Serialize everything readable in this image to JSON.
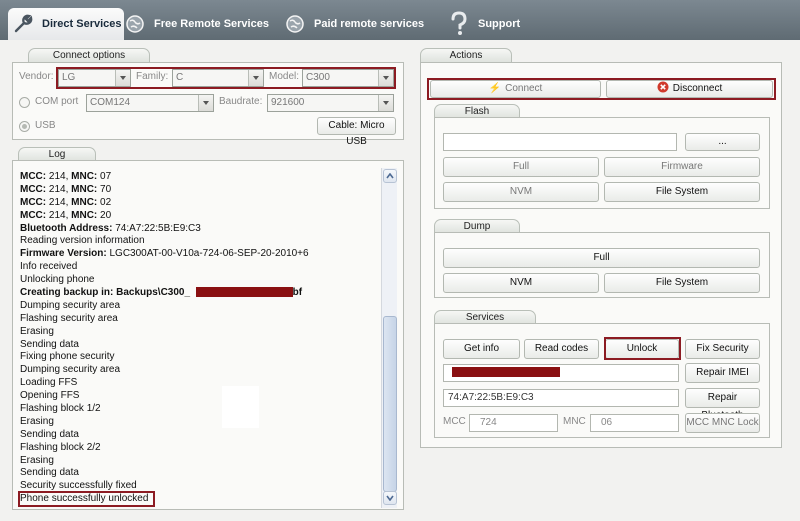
{
  "tabs": [
    {
      "label": "Direct Services",
      "icon": "wrench-icon",
      "active": true
    },
    {
      "label": "Free Remote Services",
      "icon": "globe-icon"
    },
    {
      "label": "Paid remote services",
      "icon": "globe-icon"
    },
    {
      "label": "Support",
      "icon": "question-icon"
    }
  ],
  "connect_options": {
    "title": "Connect options",
    "vendor_label": "Vendor:",
    "vendor_value": "LG",
    "family_label": "Family:",
    "family_value": "C",
    "model_label": "Model:",
    "model_value": "C300",
    "com_label": "COM port",
    "com_value": "COM124",
    "baud_label": "Baudrate:",
    "baud_value": "921600",
    "usb_label": "USB",
    "cable_button": "Cable: Micro USB"
  },
  "log": {
    "title": "Log",
    "lines": [
      {
        "label": "MCC:",
        "text": " 214, ",
        "label2": "MNC:",
        "text2": " 07"
      },
      {
        "label": "MCC:",
        "text": " 214, ",
        "label2": "MNC:",
        "text2": " 70"
      },
      {
        "label": "MCC:",
        "text": " 214, ",
        "label2": "MNC:",
        "text2": " 02"
      },
      {
        "label": "MCC:",
        "text": " 214, ",
        "label2": "MNC:",
        "text2": " 20"
      },
      {
        "label": "Bluetooth Address:",
        "text": " 74:A7:22:5B:E9:C3"
      },
      {
        "text": "Reading version information"
      },
      {
        "label": "Firmware Version:",
        "text": " LGC300AT-00-V10a-724-06-SEP-20-2010+6"
      },
      {
        "text": "Info received"
      },
      {
        "text": "Unlocking phone"
      },
      {
        "bold": "Creating backup in: Backups\\C300_",
        "suffix": "sbf"
      },
      {
        "text": "Dumping security area"
      },
      {
        "text": "Flashing security area"
      },
      {
        "text": "Erasing"
      },
      {
        "text": "Sending data"
      },
      {
        "text": "Fixing phone security"
      },
      {
        "text": "Dumping security area"
      },
      {
        "text": "Loading FFS"
      },
      {
        "text": "Opening FFS"
      },
      {
        "text": "Flashing block 1/2"
      },
      {
        "text": "Erasing"
      },
      {
        "text": "Sending data"
      },
      {
        "text": "Flashing block 2/2"
      },
      {
        "text": "Erasing"
      },
      {
        "text": "Sending data"
      },
      {
        "text": "Security successfully fixed"
      },
      {
        "text": "Phone successfully unlocked"
      }
    ]
  },
  "actions": {
    "title": "Actions",
    "connect_button": "Connect",
    "disconnect_button": "Disconnect"
  },
  "flash": {
    "title": "Flash",
    "path_value": "",
    "browse_button": "...",
    "full_button": "Full",
    "firmware_button": "Firmware",
    "nvm_button": "NVM",
    "filesystem_button": "File System"
  },
  "dump": {
    "title": "Dump",
    "full_button": "Full",
    "nvm_button": "NVM",
    "filesystem_button": "File System"
  },
  "services": {
    "title": "Services",
    "get_info_button": "Get info",
    "read_codes_button": "Read codes",
    "unlock_button": "Unlock",
    "fix_security_button": "Fix Security",
    "repair_imei_button": "Repair IMEI",
    "bt_value": "74:A7:22:5B:E9:C3",
    "repair_bt_button": "Repair Bluetooth",
    "mcc_label": "MCC",
    "mcc_value": "724",
    "mnc_label": "MNC",
    "mnc_value": "06",
    "mcc_mnc_lock_button": "MCC MNC Lock"
  },
  "colors": {
    "highlight_red": "#8c1b22",
    "tabbar": "#6b7780",
    "disconnect_icon": "#d03a2c"
  }
}
